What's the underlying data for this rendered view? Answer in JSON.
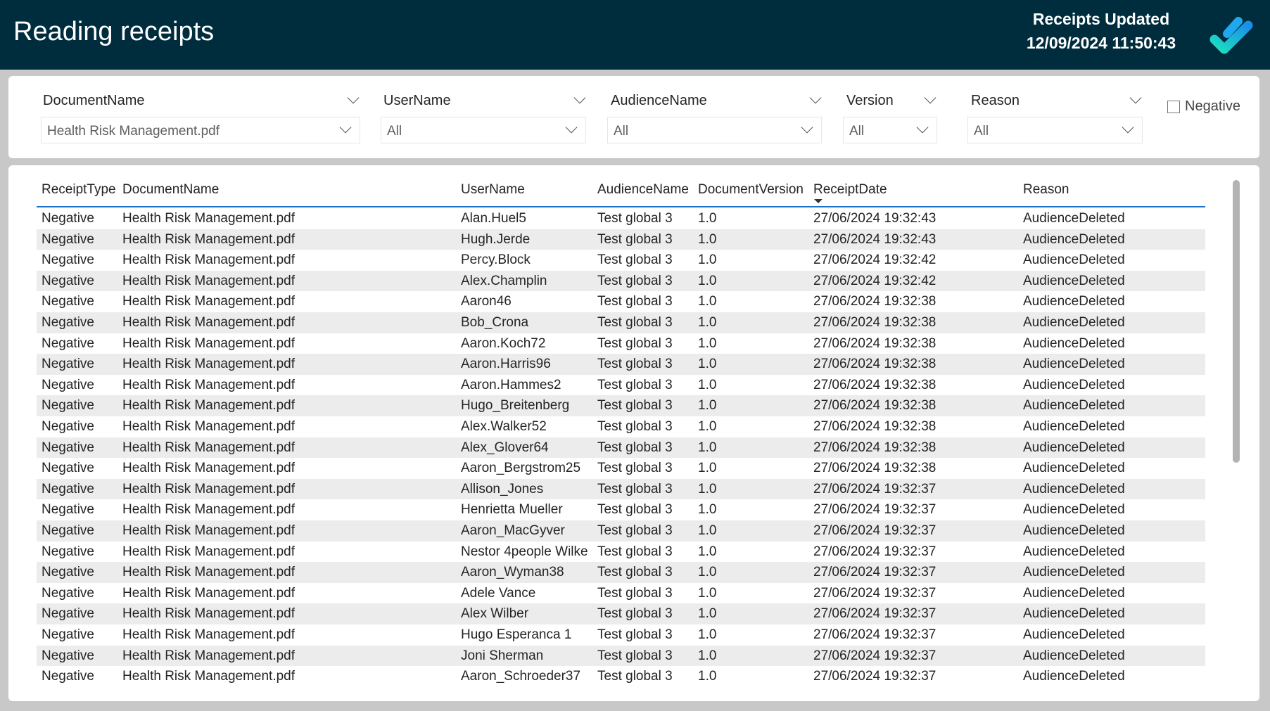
{
  "header": {
    "title": "Reading receipts",
    "updated_label": "Receipts Updated",
    "updated_time": "12/09/2024 11:50:43",
    "logo_icon": "check-logo-icon"
  },
  "filters": [
    {
      "label": "DocumentName",
      "value": "Health Risk Management.pdf"
    },
    {
      "label": "UserName",
      "value": "All"
    },
    {
      "label": "AudienceName",
      "value": "All"
    },
    {
      "label": "Version",
      "value": "All"
    },
    {
      "label": "Reason",
      "value": "All"
    }
  ],
  "negative_checkbox": {
    "label": "Negative",
    "checked": false
  },
  "table": {
    "columns": [
      "ReceiptType",
      "DocumentName",
      "UserName",
      "AudienceName",
      "DocumentVersion",
      "ReceiptDate",
      "Reason"
    ],
    "sorted_column": "ReceiptDate",
    "sort_direction": "descending",
    "users": [
      "Alan.Huel5",
      "Hugh.Jerde",
      "Percy.Block",
      "Alex.Champlin",
      "Aaron46",
      "Bob_Crona",
      "Aaron.Koch72",
      "Aaron.Harris96",
      "Aaron.Hammes2",
      "Hugo_Breitenberg",
      "Alex.Walker52",
      "Alex_Glover64",
      "Aaron_Bergstrom25",
      "Allison_Jones",
      "Henrietta Mueller",
      "Aaron_MacGyver",
      "Nestor 4people Wilke",
      "Aaron_Wyman38",
      "Adele Vance",
      "Alex Wilber",
      "Hugo Esperanca 1",
      "Joni Sherman",
      "Aaron_Schroeder37"
    ],
    "dates": [
      "27/06/2024 19:32:43",
      "27/06/2024 19:32:43",
      "27/06/2024 19:32:42",
      "27/06/2024 19:32:42",
      "27/06/2024 19:32:38",
      "27/06/2024 19:32:38",
      "27/06/2024 19:32:38",
      "27/06/2024 19:32:38",
      "27/06/2024 19:32:38",
      "27/06/2024 19:32:38",
      "27/06/2024 19:32:38",
      "27/06/2024 19:32:38",
      "27/06/2024 19:32:38",
      "27/06/2024 19:32:37",
      "27/06/2024 19:32:37",
      "27/06/2024 19:32:37",
      "27/06/2024 19:32:37",
      "27/06/2024 19:32:37",
      "27/06/2024 19:32:37",
      "27/06/2024 19:32:37",
      "27/06/2024 19:32:37",
      "27/06/2024 19:32:37",
      "27/06/2024 19:32:37"
    ],
    "receipt_type": "Negative",
    "document": "Health Risk Management.pdf",
    "audience": "Test global 3",
    "version": "1.0",
    "reason": "AudienceDeleted"
  }
}
